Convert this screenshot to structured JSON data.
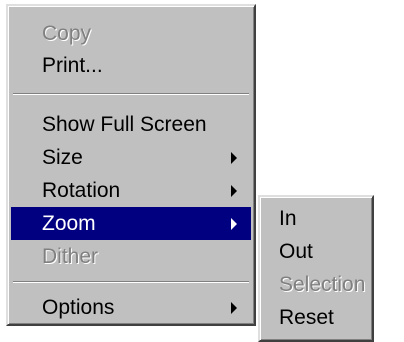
{
  "context_menu": {
    "items": [
      {
        "label": "Copy",
        "disabled": true
      },
      {
        "label": "Print..."
      },
      {
        "label": "Show Full Screen"
      },
      {
        "label": "Size",
        "has_submenu": true
      },
      {
        "label": "Rotation",
        "has_submenu": true
      },
      {
        "label": "Zoom",
        "has_submenu": true,
        "highlighted": true
      },
      {
        "label": "Dither",
        "disabled": true
      },
      {
        "label": "Options",
        "has_submenu": true
      }
    ]
  },
  "zoom_submenu": {
    "items": [
      {
        "label": "In"
      },
      {
        "label": "Out"
      },
      {
        "label": "Selection",
        "disabled": true
      },
      {
        "label": "Reset"
      }
    ]
  },
  "colors": {
    "menu_background": "#c0c0c0",
    "highlight_background": "#000080",
    "highlight_text": "#ffffff",
    "disabled_text": "#808080"
  },
  "icons": {
    "submenu_indicator": "arrow-right-icon"
  }
}
